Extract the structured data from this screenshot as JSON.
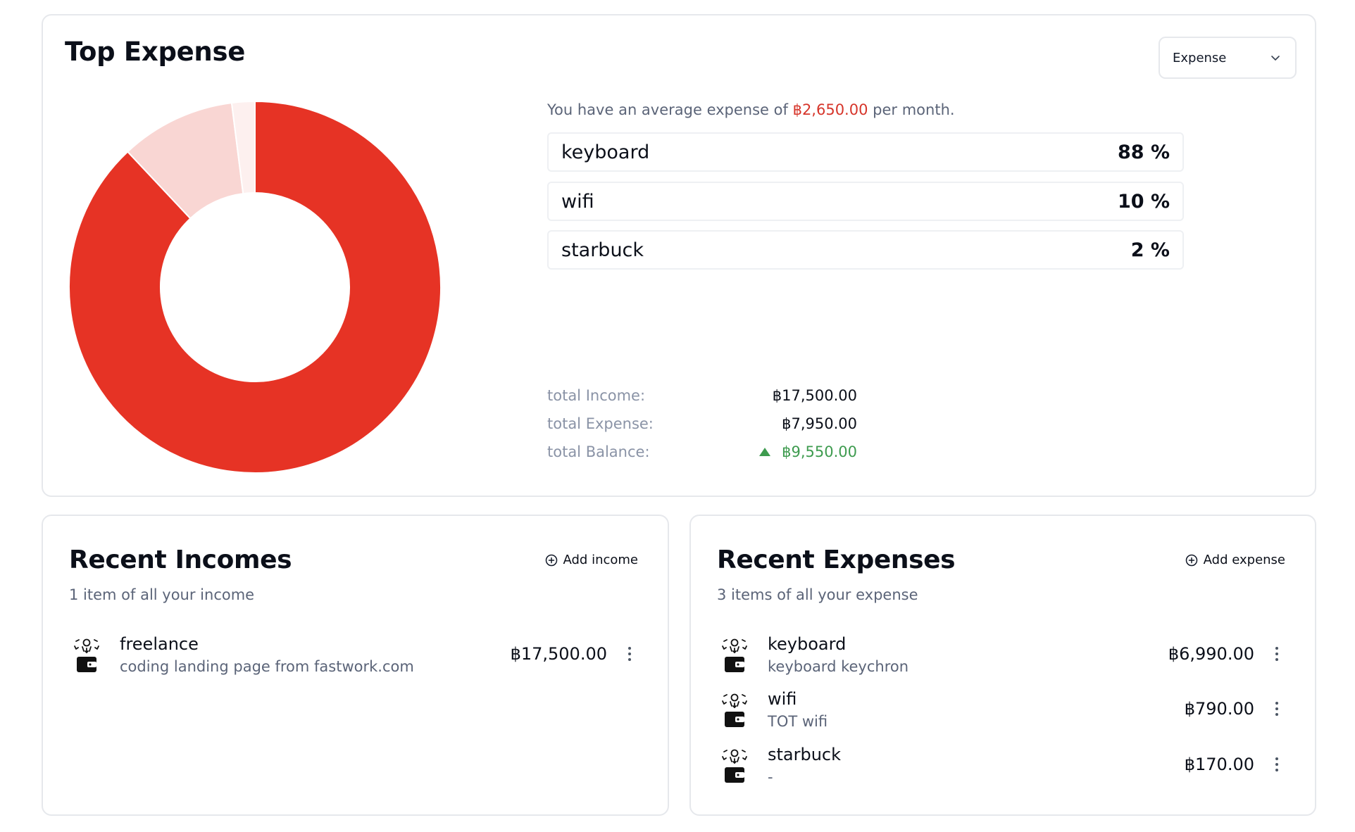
{
  "top_expense": {
    "title": "Top Expense",
    "select_value": "Expense",
    "avg_prefix": "You have an average expense of",
    "avg_amount": "฿2,650.00",
    "avg_suffix": "per month.",
    "categories": [
      {
        "name": "keyboard",
        "pct": "88 %"
      },
      {
        "name": "wifi",
        "pct": "10 %"
      },
      {
        "name": "starbuck",
        "pct": "2 %"
      }
    ],
    "totals": {
      "income_label": "total Income:",
      "income_value": "฿17,500.00",
      "expense_label": "total Expense:",
      "expense_value": "฿7,950.00",
      "balance_label": "total Balance:",
      "balance_value": "฿9,550.00"
    }
  },
  "chart_data": {
    "type": "pie",
    "categories": [
      "keyboard",
      "wifi",
      "starbuck"
    ],
    "values": [
      88,
      10,
      2
    ],
    "colors": [
      "#e63325",
      "#f9d6d3",
      "#fdf0ef"
    ]
  },
  "recent_incomes": {
    "title": "Recent Incomes",
    "subtitle": "1 item of all your income",
    "add_label": "Add income",
    "items": [
      {
        "name": "freelance",
        "desc": "coding landing page from fastwork.com",
        "amount": "฿17,500.00",
        "icon": "wallet-icon"
      }
    ]
  },
  "recent_expenses": {
    "title": "Recent Expenses",
    "subtitle": "3 items of all your expense",
    "add_label": "Add expense",
    "items": [
      {
        "name": "keyboard",
        "desc": "keyboard keychron",
        "amount": "฿6,990.00",
        "icon": "wallet-icon"
      },
      {
        "name": "wifi",
        "desc": "TOT wifi",
        "amount": "฿790.00",
        "icon": "wallet-icon"
      },
      {
        "name": "starbuck",
        "desc": "-",
        "amount": "฿170.00",
        "icon": "wallet-icon"
      }
    ]
  },
  "colors": {
    "accent_red": "#e63325",
    "positive_green": "#3e9b4f",
    "muted_text": "#5b6478",
    "border": "#e6e8ec"
  }
}
